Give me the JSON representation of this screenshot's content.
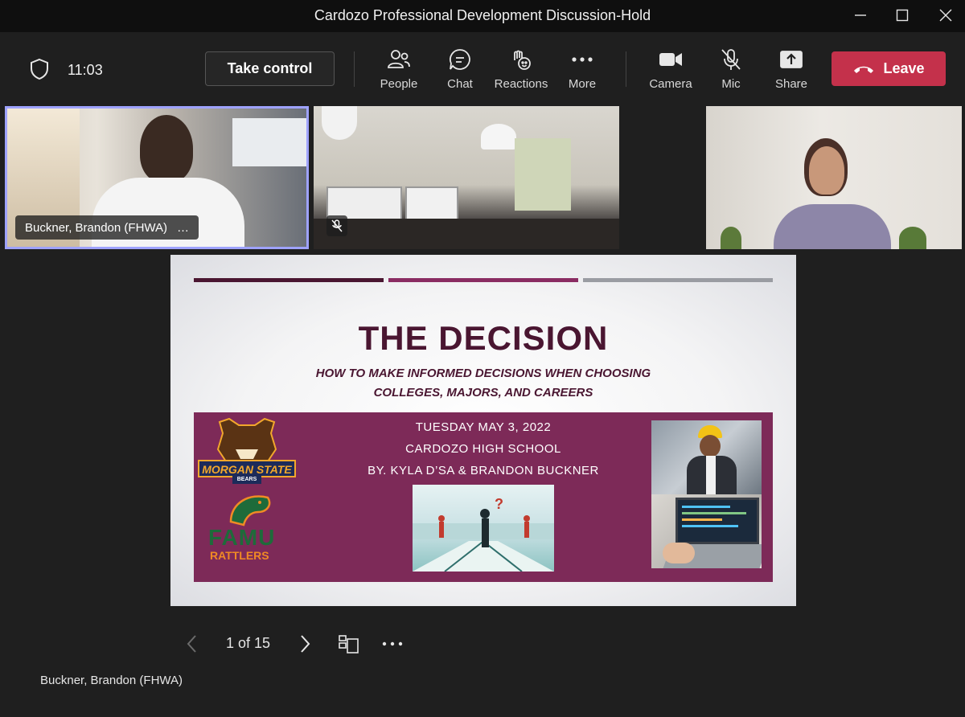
{
  "window": {
    "title": "Cardozo Professional Development Discussion-Hold"
  },
  "toolbar": {
    "time": "11:03",
    "take_control": "Take control",
    "people": "People",
    "chat": "Chat",
    "reactions": "Reactions",
    "more": "More",
    "camera": "Camera",
    "mic": "Mic",
    "share": "Share",
    "leave": "Leave"
  },
  "tiles": {
    "presenter_name": "Buckner, Brandon (FHWA)",
    "presenter_menu": "…"
  },
  "slide": {
    "title": "THE DECISION",
    "subtitle_line1": "HOW TO MAKE INFORMED DECISIONS WHEN CHOOSING",
    "subtitle_line2": "COLLEGES, MAJORS, AND CAREERS",
    "date": "TUESDAY MAY 3, 2022",
    "school": "CARDOZO HIGH SCHOOL",
    "authors": "BY. KYLA D’SA & BRANDON BUCKNER",
    "logo_msu_main": "MORGAN STATE",
    "logo_msu_sub": "BEARS",
    "logo_famu_main": "FAMU",
    "logo_famu_sub": "RATTLERS",
    "bar_colors": [
      "#4a1631",
      "#8a2c62",
      "#9a9ca2"
    ]
  },
  "bottom": {
    "page_indicator": "1 of 15",
    "presenter_label": "Buckner, Brandon (FHWA)"
  },
  "colors": {
    "accent": "#9ea2ff",
    "leave": "#c4314b",
    "slide_title": "#4a1631",
    "band": "#7d2a58"
  }
}
